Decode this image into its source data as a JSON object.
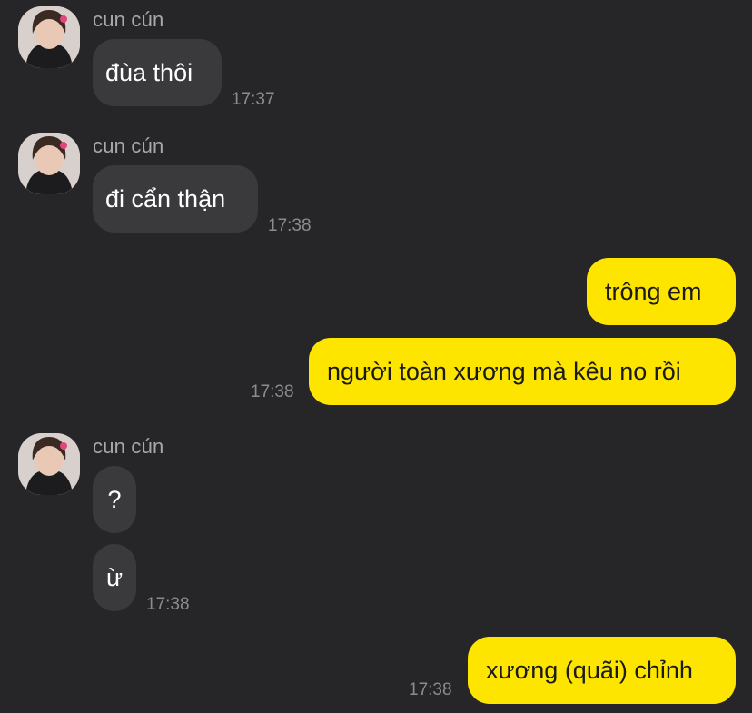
{
  "contact": {
    "name": "cun cún"
  },
  "messages": [
    {
      "sender": "them",
      "text": "đùa thôi",
      "time": "17:37"
    },
    {
      "sender": "them",
      "text": "đi cẩn thận",
      "time": "17:38"
    },
    {
      "sender": "me",
      "text": "trông em"
    },
    {
      "sender": "me",
      "text": "người toàn xương mà kêu no rồi",
      "time": "17:38"
    },
    {
      "sender": "them",
      "text": "?"
    },
    {
      "sender": "them",
      "text": "ừ",
      "time": "17:38"
    },
    {
      "sender": "me",
      "text": "xương (quãi) chỉnh",
      "time": "17:38"
    }
  ],
  "colors": {
    "background": "#262628",
    "incoming_bubble": "#3a3a3d",
    "outgoing_bubble": "#fde500",
    "timestamp": "#8c8c90"
  }
}
